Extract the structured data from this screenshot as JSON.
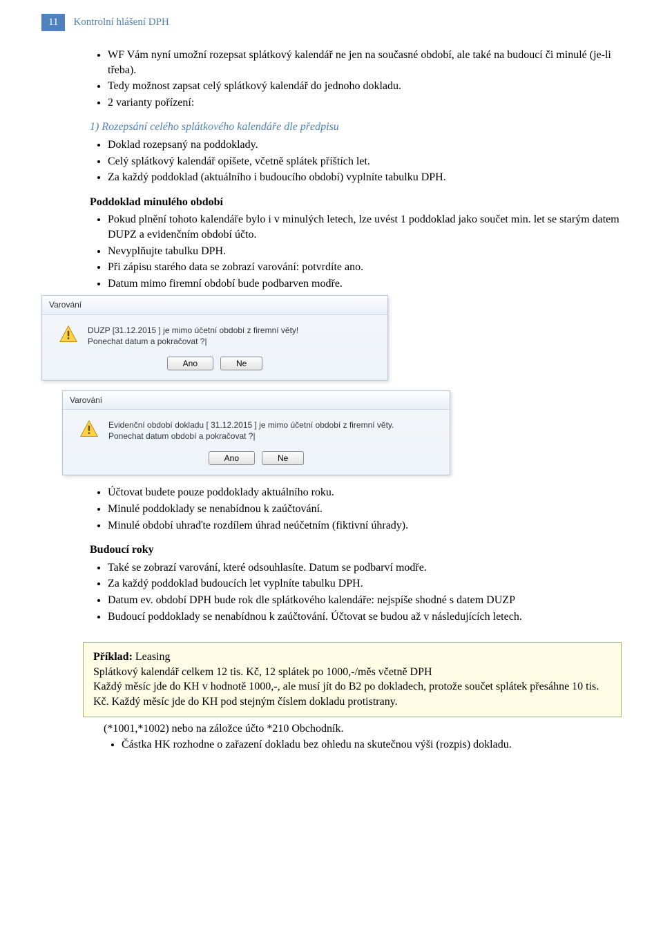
{
  "header": {
    "page_number": "11",
    "title": "Kontrolní hlášení DPH"
  },
  "intro_bullets": [
    "WF Vám nyní umožní rozepsat splátkový kalendář ne jen na současné období, ale také na budoucí či minulé (je-li třeba).",
    "Tedy možnost zapsat celý splátkový kalendář do jednoho dokladu.",
    "2 varianty pořízení:"
  ],
  "predpis_heading": "1) Rozepsání celého splátkového kalendáře dle předpisu",
  "predpis_bullets": [
    "Doklad rozepsaný na poddoklady.",
    "Celý splátkový kalendář opíšete, včetně splátek příštích let.",
    "Za každý poddoklad (aktuálního i budoucího období) vyplníte tabulku DPH."
  ],
  "minule_heading": "Poddoklad minulého období",
  "minule_bullets": [
    "Pokud plnění tohoto kalendáře bylo i v minulých letech, lze uvést 1 poddoklad jako součet min. let se starým datem DUPZ a evidenčním období účto.",
    "Nevyplňujte tabulku DPH.",
    "Při zápisu starého data se zobrazí varování: potvrdíte ano.",
    "Datum mimo firemní období bude podbarven modře."
  ],
  "dialog1": {
    "title": "Varování",
    "line1": "DUZP [31.12.2015 ] je mimo účetní období z firemní věty!",
    "line2": "Ponechat datum a pokračovat ?|",
    "yes": "Ano",
    "no": "Ne"
  },
  "dialog2": {
    "title": "Varování",
    "line1": "Evidenční období dokladu [ 31.12.2015 ] je mimo účetní období z firemní věty.",
    "line2": "Ponechat datum období a pokračovat ?|",
    "yes": "Ano",
    "no": "Ne"
  },
  "after_dialog_bullets": [
    "Účtovat budete pouze poddoklady aktuálního roku.",
    "Minulé poddoklady se nenabídnou k zaúčtování.",
    "Minulé období uhraďte rozdílem úhrad neúčetním (fiktivní úhrady)."
  ],
  "budouci_heading": "Budoucí roky",
  "budouci_bullets": [
    "Také se zobrazí varování, které odsouhlasíte. Datum se podbarví modře.",
    "Za každý poddoklad budoucích let vyplníte tabulku DPH.",
    "Datum ev. období DPH bude rok dle splátkového kalendáře: nejspíše shodné s datem DUZP",
    "Budoucí poddoklady se nenabídnou k zaúčtování. Účtovat se budou až v následujících letech."
  ],
  "example": {
    "label": "Příklad:",
    "topic": " Leasing",
    "line1": "Splátkový kalendář celkem 12 tis. Kč, 12 splátek po 1000,-/měs včetně DPH",
    "line2": "Každý měsíc jde do KH v hodnotě 1000,-, ale musí jít do B2 po dokladech, protože součet splátek přesáhne 10 tis. Kč. Každý měsíc jde do KH pod stejným číslem dokladu protistrany."
  },
  "tail_text": "(*1001,*1002) nebo na záložce účto *210 Obchodník.",
  "tail_bullets": [
    "Částka HK rozhodne o zařazení dokladu bez ohledu na skutečnou výši (rozpis) dokladu."
  ]
}
